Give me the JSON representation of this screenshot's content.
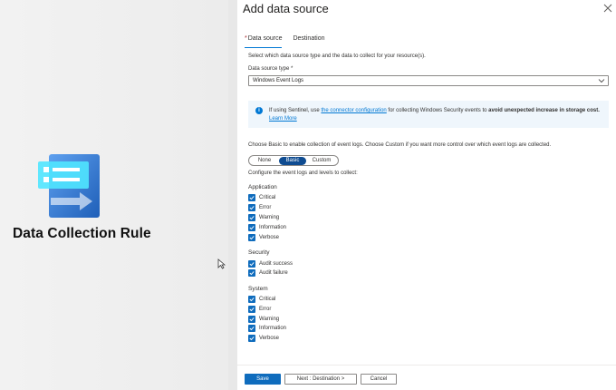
{
  "background": {
    "feature_title": "Data Collection Rule",
    "icon": "data-collection-rule-icon"
  },
  "panel": {
    "title": "Add data source",
    "close_icon": "close-icon"
  },
  "tabs": [
    {
      "label": "Data source",
      "required": true,
      "active": true
    },
    {
      "label": "Destination",
      "required": false,
      "active": false
    }
  ],
  "form": {
    "description": "Select which data source type and the data to collect for your resource(s).",
    "type_label": "Data source type",
    "type_required_mark": "*",
    "type_value": "Windows Event Logs"
  },
  "info": {
    "prefix": "If using Sentinel, use ",
    "link": "the connector configuration",
    "middle": " for collecting Windows Security events to ",
    "emphasis": "avoid unexpected increase in storage cost.",
    "space": " ",
    "learn_more": "Learn More"
  },
  "collection": {
    "choose_text": "Choose Basic to enable collection of event logs. Choose Custom if you want more control over which event logs are collected.",
    "options": [
      "None",
      "Basic",
      "Custom"
    ],
    "selected": "Basic",
    "configure_text": "Configure the event logs and levels to collect:"
  },
  "groups": [
    {
      "title": "Application",
      "items": [
        "Critical",
        "Error",
        "Warning",
        "Information",
        "Verbose"
      ]
    },
    {
      "title": "Security",
      "items": [
        "Audit success",
        "Audit failure"
      ]
    },
    {
      "title": "System",
      "items": [
        "Critical",
        "Error",
        "Warning",
        "Information",
        "Verbose"
      ]
    }
  ],
  "footer": {
    "save": "Save",
    "next": "Next : Destination >",
    "cancel": "Cancel"
  },
  "colors": {
    "accent": "#0f6cbd",
    "info_bg": "#eff6fc",
    "selected_pill": "#0f4c91"
  }
}
